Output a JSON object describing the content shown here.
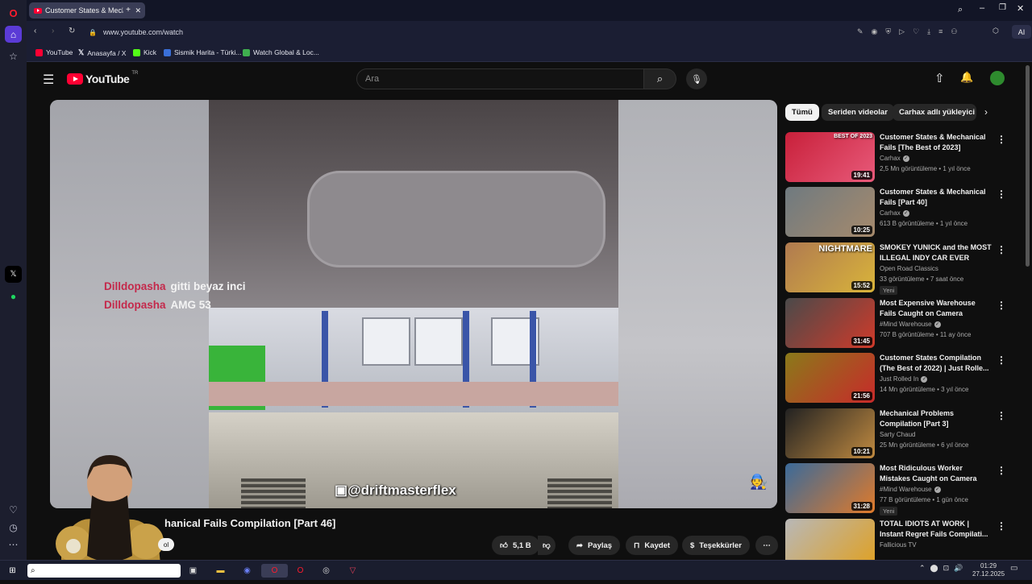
{
  "browser": {
    "tab_title": "Customer States & Mech",
    "url": "www.youtube.com/watch",
    "bookmarks": [
      {
        "label": "YouTube",
        "color": "#ff0033"
      },
      {
        "label": "Anasayfa / X",
        "color": "#ffffff"
      },
      {
        "label": "Kick",
        "color": "#53fc18"
      },
      {
        "label": "Sismik Harita - Türki...",
        "color": "#3a6fd8"
      },
      {
        "label": "Watch Global & Loc...",
        "color": "#3fb04f"
      }
    ],
    "ai_label": "AI"
  },
  "youtube": {
    "logo_text": "YouTube",
    "region": "TR",
    "search_placeholder": "Ara",
    "chat": [
      {
        "user": "Dilldopasha",
        "message": "gitti beyaz inci"
      },
      {
        "user": "Dilldopasha",
        "message": "AMG 53"
      }
    ],
    "watermark": "@driftmasterflex",
    "video_title": "hanical Fails Compilation [Part 46]",
    "subscribe_fragment": "ol",
    "actions": {
      "likes": "5,1 B",
      "share": "Paylaş",
      "save": "Kaydet",
      "thanks": "Teşekkürler"
    },
    "chips": [
      "Tümü",
      "Seriden videolar",
      "Carhax adlı yükleyici"
    ],
    "recommendations": [
      {
        "title": "Customer States & Mechanical Fails [The Best of 2023]",
        "channel": "Carhax",
        "verified": true,
        "meta": "2,5 Mn görüntüleme • 1 yıl önce",
        "duration": "19:41",
        "badge": "",
        "thumb_text": "BEST OF 2023",
        "colors": [
          "#c8203a",
          "#e85a7a"
        ]
      },
      {
        "title": "Customer States & Mechanical Fails [Part 40]",
        "channel": "Carhax",
        "verified": true,
        "meta": "613 B görüntüleme • 1 yıl önce",
        "duration": "10:25",
        "badge": "",
        "thumb_text": "",
        "colors": [
          "#6f7a80",
          "#a68a6c"
        ]
      },
      {
        "title": "SMOKEY YUNICK and the MOST ILLEGAL INDY CAR EVER BUIL...",
        "channel": "Open Road Classics",
        "verified": false,
        "meta": "33 görüntüleme • 7 saat önce",
        "duration": "15:52",
        "badge": "Yeni",
        "thumb_text": "NIGHTMARE",
        "colors": [
          "#b07a50",
          "#d9b43a"
        ]
      },
      {
        "title": "Most Expensive Warehouse Fails Caught on Camera",
        "channel": "#Mind Warehouse",
        "verified": true,
        "meta": "707 B görüntüleme • 11 ay önce",
        "duration": "31:45",
        "badge": "",
        "thumb_text": "",
        "colors": [
          "#4a4a4a",
          "#d03a2a"
        ]
      },
      {
        "title": "Customer States Compilation (The Best of 2022) | Just Rolle...",
        "channel": "Just Rolled In",
        "verified": true,
        "meta": "14 Mn görüntüleme • 3 yıl önce",
        "duration": "21:56",
        "badge": "",
        "thumb_text": "",
        "colors": [
          "#8a7a1a",
          "#c82a2a"
        ]
      },
      {
        "title": "Mechanical Problems Compilation [Part 3]",
        "channel": "Sarty Chaud",
        "verified": false,
        "meta": "25 Mn görüntüleme • 6 yıl önce",
        "duration": "10:21",
        "badge": "",
        "thumb_text": "",
        "colors": [
          "#222222",
          "#c08a40"
        ]
      },
      {
        "title": "Most Ridiculous Worker Mistakes Caught on Camera",
        "channel": "#Mind Warehouse",
        "verified": true,
        "meta": "77 B görüntüleme • 1 gün önce",
        "duration": "31:28",
        "badge": "Yeni",
        "thumb_text": "",
        "colors": [
          "#3a6a9a",
          "#e07a2a"
        ]
      },
      {
        "title": "TOTAL IDIOTS AT WORK | Instant Regret Fails Compilati...",
        "channel": "Fallicious TV",
        "verified": false,
        "meta": "",
        "duration": "",
        "badge": "",
        "thumb_text": "",
        "colors": [
          "#b8b8b8",
          "#e0a020"
        ]
      }
    ]
  },
  "taskbar": {
    "time": "01:29",
    "date": "27.12.2025"
  }
}
